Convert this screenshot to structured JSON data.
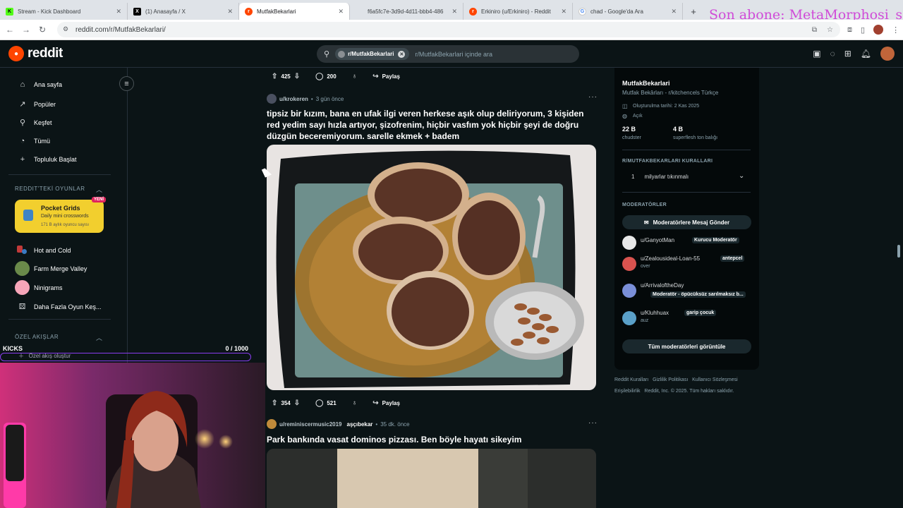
{
  "browser": {
    "tabs": [
      {
        "label": "Stream - Kick Dashboard",
        "icon": "kick-icon",
        "color": "#53fc18",
        "glyph": "K",
        "active": false
      },
      {
        "label": "(1) Anasayfa / X",
        "icon": "x-icon",
        "color": "#000000",
        "glyph": "X",
        "active": false
      },
      {
        "label": "MutfakBekarlari",
        "icon": "reddit-icon",
        "color": "#ff4500",
        "glyph": "r",
        "active": true
      },
      {
        "label": "f6a5fc7e-3d9d-4d11-bbb4-486",
        "icon": "page-icon",
        "color": "#9aa0a6",
        "glyph": "",
        "active": false
      },
      {
        "label": "Erkiniro (u/Erkiniro) - Reddit",
        "icon": "reddit-icon",
        "color": "#ff4500",
        "glyph": "r",
        "active": false
      },
      {
        "label": "chad - Google'da Ara",
        "icon": "google-icon",
        "color": "#4285f4",
        "glyph": "G",
        "active": false
      }
    ],
    "url": "reddit.com/r/MutfakBekarlari/",
    "overlay_text": "Son abone: MetaMorphosi_s"
  },
  "header": {
    "logo_text": "reddit",
    "search_chip": "r/MutfakBekarlari",
    "search_placeholder": "r/MutfakBekarlari içinde ara"
  },
  "sidebar": {
    "items": [
      {
        "label": "Ana sayfa",
        "icon": "home-icon",
        "glyph": "⌂"
      },
      {
        "label": "Popüler",
        "icon": "popular-icon",
        "glyph": "↗"
      },
      {
        "label": "Keşfet",
        "icon": "explore-icon",
        "glyph": "⚲"
      },
      {
        "label": "Tümü",
        "icon": "all-icon",
        "glyph": "◔"
      },
      {
        "label": "Topluluk Başlat",
        "icon": "plus-icon",
        "glyph": "+"
      }
    ],
    "games_header": "REDDIT'TEKİ OYUNLAR",
    "game_card": {
      "title": "Pocket Grids",
      "subtitle": "Daily mini crosswords",
      "players": "171 B aylık oyuncu sayısı",
      "badge": "YENİ"
    },
    "games": [
      {
        "label": "Hot and Cold",
        "color": "#c23a3a"
      },
      {
        "label": "Farm Merge Valley",
        "color": "#6a8a4a"
      },
      {
        "label": "Ninigrams",
        "color": "#f6a5b8"
      },
      {
        "label": "Daha Fazla Oyun Keş...",
        "color": ""
      }
    ],
    "feeds_header": "ÖZEL AKIŞLAR",
    "create_feed": "Özel akış oluştur"
  },
  "kicks": {
    "label": "KICKS",
    "count": "0  / 1000"
  },
  "feed": {
    "top_actions": {
      "votes": "425",
      "comments": "200",
      "share": "Paylaş"
    },
    "post1": {
      "user": "u/krokeren",
      "time": "3 gün önce",
      "title": "tipsiz bir kızım, bana en ufak ilgi veren herkese aşık olup deliriyorum, 3 kişiden red yedim sayı hızla artıyor, şizofrenim, hiçbir vasfım yok hiçbir şeyi de doğru düzgün beceremiyorum. sarelle ekmek + badem",
      "votes": "354",
      "comments": "521",
      "share": "Paylaş"
    },
    "post2": {
      "user": "u/reminiscermusic2019",
      "flair": "aşçıbekar",
      "time": "35 dk. önce",
      "title": "Park bankında vasat dominos pizzası. Ben böyle hayatı sikeyim"
    }
  },
  "community": {
    "name": "MutfakBekarlari",
    "description": "Mutfak Bekârları - r/kitchencels Türkçe",
    "created": "Oluşturulma tarihi: 2 Kas 2025",
    "visibility": "Açık",
    "stats": [
      {
        "value": "22 B",
        "label": "chudster"
      },
      {
        "value": "4 B",
        "label": "superflesh ton balığı"
      }
    ],
    "rules_header": "R/MUTFAKBEKARLARI KURALLARI",
    "rule": {
      "num": "1",
      "text": "milyarlar tıkınmalı"
    },
    "mods_header": "MODERATÖRLER",
    "message_mods": "Moderatörlere Mesaj Gönder",
    "mods": [
      {
        "name": "u/GanyotMan",
        "flair": "Kurucu Moderatör",
        "sub": "",
        "color": "#e8e8e8"
      },
      {
        "name": "u/Zealousideal-Loan-55",
        "flair": "antepcel",
        "sub": "over",
        "color": "#d9534f"
      },
      {
        "name": "u/ArrivaloftheDay",
        "flair": "Moderatör - öpücüksüz sarılmaksız b...",
        "sub": "",
        "color": "#7a8fd8"
      },
      {
        "name": "u/Kluhhuax",
        "flair": "garip çocuk",
        "sub": "auz",
        "color": "#5aa0c8"
      }
    ],
    "view_all_mods": "Tüm moderatörleri görüntüle"
  },
  "footer": {
    "line1": [
      "Reddit Kuralları",
      "Gizlilik Politikası",
      "Kullanıcı Sözleşmesi"
    ],
    "line2": [
      "Erişilebilirlik",
      "Reddit, Inc. © 2025. Tüm hakları saklıdır."
    ]
  }
}
